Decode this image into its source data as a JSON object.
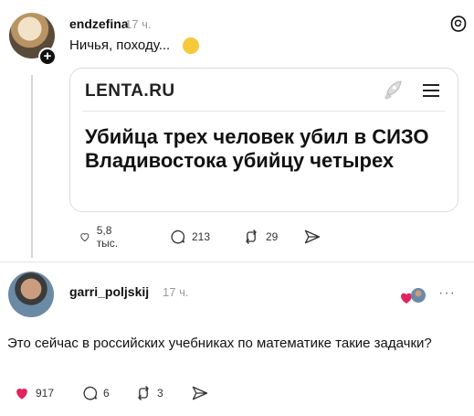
{
  "post1": {
    "username": "endzefina",
    "time": "17 ч.",
    "text": "Ничья, походу...",
    "emoji_icon": "thinking-face-icon",
    "link_card": {
      "site_logo": "LENTA.RU",
      "headline": "Убийца трех человек убил в СИЗО Владивостока убийцу четырех"
    },
    "actions": {
      "likes": "5,8 тыс.",
      "replies": "213",
      "reposts": "29"
    }
  },
  "post2": {
    "username": "garri_poljskij",
    "time": "17 ч.",
    "text": "Это сейчас в российских учебниках по математике такие задачки?",
    "more_label": "···",
    "actions": {
      "likes": "917",
      "replies": "6",
      "reposts": "3"
    }
  },
  "colors": {
    "like_active": "#e0245e",
    "muted_text": "#999999",
    "border": "#dcdcdc"
  }
}
